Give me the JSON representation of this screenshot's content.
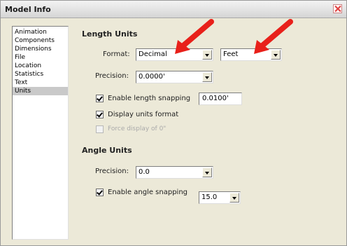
{
  "window": {
    "title": "Model Info"
  },
  "sidebar": {
    "items": [
      {
        "label": "Animation",
        "selected": false
      },
      {
        "label": "Components",
        "selected": false
      },
      {
        "label": "Dimensions",
        "selected": false
      },
      {
        "label": "File",
        "selected": false
      },
      {
        "label": "Location",
        "selected": false
      },
      {
        "label": "Statistics",
        "selected": false
      },
      {
        "label": "Text",
        "selected": false
      },
      {
        "label": "Units",
        "selected": true
      }
    ]
  },
  "length_units": {
    "heading": "Length Units",
    "format_label": "Format:",
    "format_value": "Decimal",
    "unit_value": "Feet",
    "precision_label": "Precision:",
    "precision_value": "0.0000'",
    "snapping_label": "Enable length snapping",
    "snapping_checked": true,
    "snapping_value": "0.0100'",
    "display_units_label": "Display units format",
    "display_units_checked": true,
    "force_display_label": "Force display of 0\"",
    "force_display_checked": false,
    "force_display_enabled": false
  },
  "angle_units": {
    "heading": "Angle Units",
    "precision_label": "Precision:",
    "precision_value": "0.0",
    "snapping_label": "Enable angle snapping",
    "snapping_checked": true,
    "snapping_value": "15.0"
  },
  "annotation_color": "#e8201a"
}
